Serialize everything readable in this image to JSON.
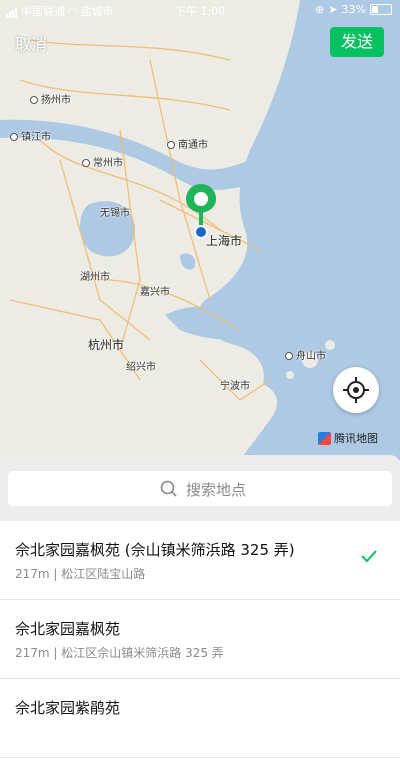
{
  "status_bar": {
    "carrier": "中国联通",
    "location": "盐城市",
    "time": "下午 1:00",
    "battery": "33%"
  },
  "nav": {
    "cancel_label": "取消",
    "send_label": "发送"
  },
  "map": {
    "cities": [
      "扬州市",
      "镇江市",
      "南通市",
      "常州市",
      "无锡市",
      "上海市",
      "湖州市",
      "嘉兴市",
      "杭州市",
      "绍兴市",
      "舟山市",
      "宁波市"
    ],
    "attribution": "腾讯地图",
    "pin_color": "#1fb35a"
  },
  "search": {
    "placeholder": "搜索地点"
  },
  "results": [
    {
      "title": "佘北家园嘉枫苑 (佘山镇米筛浜路 325 弄)",
      "subtitle": "217m | 松江区陆宝山路",
      "selected": true
    },
    {
      "title": "佘北家园嘉枫苑",
      "subtitle": "217m | 松江区佘山镇米筛浜路 325 弄",
      "selected": false
    },
    {
      "title": "佘北家园紫鹃苑",
      "subtitle": "",
      "selected": false
    }
  ],
  "colors": {
    "accent": "#07c160",
    "check": "#07c160"
  }
}
